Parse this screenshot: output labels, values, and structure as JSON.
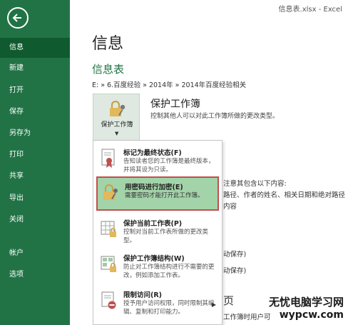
{
  "window": {
    "title": "信息表.xlsx - Excel"
  },
  "sidebar": {
    "items": [
      {
        "label": "信息"
      },
      {
        "label": "新建"
      },
      {
        "label": "打开"
      },
      {
        "label": "保存"
      },
      {
        "label": "另存为"
      },
      {
        "label": "打印"
      },
      {
        "label": "共享"
      },
      {
        "label": "导出"
      },
      {
        "label": "关闭"
      },
      {
        "label": "帐户"
      },
      {
        "label": "选项"
      }
    ],
    "colors": {
      "background": "#217346",
      "active": "#0f5a2e"
    }
  },
  "main": {
    "title": "信息",
    "section_title": "信息表",
    "breadcrumb": "E: » 6.百度经验 » 2014年 » 2014年百度经验相关",
    "protect": {
      "button_label": "保护工作簿",
      "title": "保护工作簿",
      "description": "控制其他人可以对此工作簿所做的更改类型。"
    },
    "background_text": {
      "line1": "注意其包含以下内容:",
      "line2": "路径、作者的姓名、相关日期和绝对路径",
      "line3": "内容",
      "line4": "动保存)",
      "line5": "动保存)",
      "line6": "页",
      "line7": "工作簿时用户可"
    }
  },
  "menu": {
    "items": [
      {
        "title": "标记为最终状态(F)",
        "description": "告知读者您的工作簿是最终版本，并将其设为只读。",
        "icon": "final-ribbon-icon"
      },
      {
        "title": "用密码进行加密(E)",
        "description": "需要密码才能打开此工作簿。",
        "icon": "lock-key-icon"
      },
      {
        "title": "保护当前工作表(P)",
        "description": "控制对当前工作表所做的更改类型。",
        "icon": "sheet-lock-icon"
      },
      {
        "title": "保护工作簿结构(W)",
        "description": "防止对工作簿结构进行不需要的更改，例如添加工作表。",
        "icon": "structure-lock-icon"
      },
      {
        "title": "限制访问(R)",
        "description": "授予用户访问权限，同时限制其编辑、复制和打印能力。",
        "icon": "restrict-access-icon"
      }
    ],
    "highlight_color": "#a3d3a9",
    "highlight_border": "#c0504d"
  },
  "watermark": {
    "text": "无忧电脑学习网",
    "url": "wypcw.com"
  }
}
